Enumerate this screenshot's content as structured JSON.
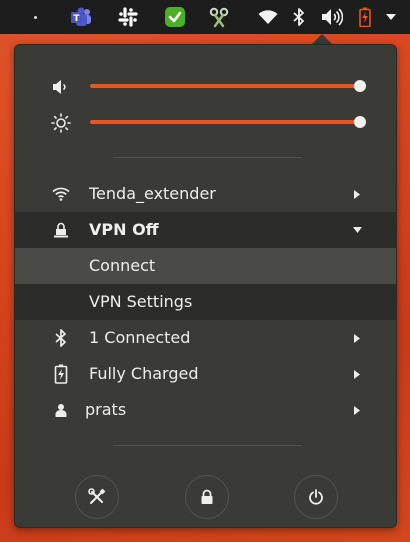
{
  "topbar": {
    "icons": [
      "dot-indicator",
      "teams-icon",
      "slack-icon",
      "checkmark-app-icon",
      "shutter-icon",
      "wifi-icon",
      "bluetooth-icon",
      "volume-icon",
      "battery-charging-icon",
      "dropdown-arrow-icon"
    ]
  },
  "sliders": {
    "volume": {
      "level": 1.0,
      "icon": "volume-low-icon"
    },
    "brightness": {
      "level": 1.0,
      "icon": "brightness-icon"
    }
  },
  "menu": {
    "wifi": {
      "label": "Tenda_extender",
      "icon": "wifi-icon"
    },
    "vpn": {
      "label": "VPN Off",
      "icon": "vpn-icon"
    },
    "vpn_connect": {
      "label": "Connect"
    },
    "vpn_settings": {
      "label": "VPN Settings"
    },
    "bluetooth": {
      "label": "1 Connected",
      "icon": "bluetooth-icon"
    },
    "battery": {
      "label": "Fully Charged",
      "icon": "battery-icon"
    },
    "user": {
      "label": "prats",
      "icon": "user-icon"
    }
  },
  "actions": {
    "settings": "settings-icon",
    "lock": "lock-icon",
    "power": "power-icon"
  },
  "colors": {
    "accent": "#e95420",
    "panel": "#3a3a37",
    "topbar": "#1d1d1d",
    "text": "#eeeeec"
  }
}
